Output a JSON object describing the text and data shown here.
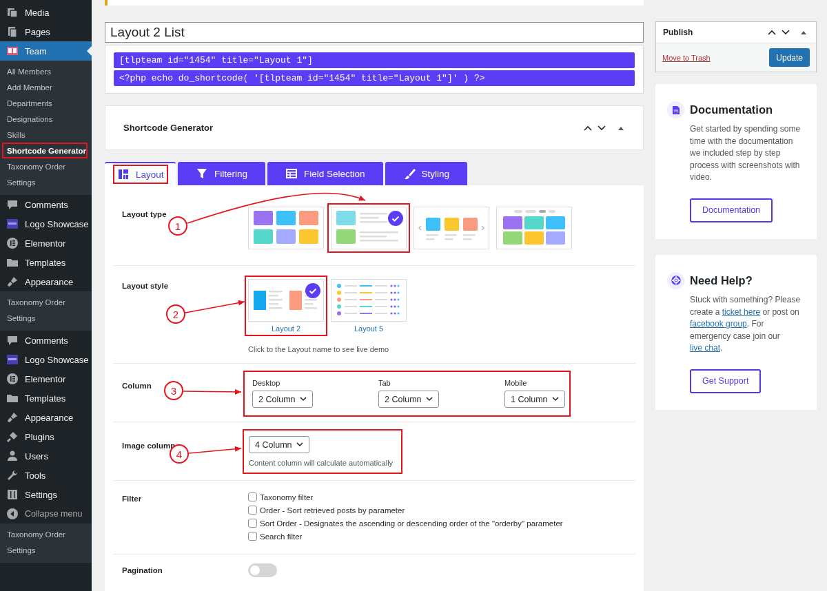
{
  "sidebar": {
    "items": [
      {
        "kind": "menu",
        "label": "Media",
        "selected": false
      },
      {
        "kind": "menu",
        "label": "Pages",
        "selected": false
      },
      {
        "kind": "menu",
        "label": "Team",
        "selected": true
      },
      {
        "kind": "submenu",
        "items": [
          {
            "label": "All Members",
            "current": false,
            "highlighted": false
          },
          {
            "label": "Add Member",
            "current": false,
            "highlighted": false
          },
          {
            "label": "Departments",
            "current": false,
            "highlighted": false
          },
          {
            "label": "Designations",
            "current": false,
            "highlighted": false
          },
          {
            "label": "Skills",
            "current": false,
            "highlighted": false
          },
          {
            "label": "Shortcode Generator",
            "current": true,
            "highlighted": true
          },
          {
            "label": "Taxonomy Order",
            "current": false,
            "highlighted": false
          },
          {
            "label": "Settings",
            "current": false,
            "highlighted": false
          }
        ]
      },
      {
        "kind": "menu",
        "label": "Comments",
        "selected": false
      },
      {
        "kind": "menu",
        "label": "Logo Showcase",
        "selected": false
      },
      {
        "kind": "menu",
        "label": "Elementor",
        "selected": false
      },
      {
        "kind": "menu",
        "label": "Templates",
        "selected": false
      },
      {
        "kind": "menu",
        "label": "Appearance",
        "selected": false
      },
      {
        "kind": "submenu",
        "items": [
          {
            "label": "Taxonomy Order",
            "current": false,
            "highlighted": false
          },
          {
            "label": "Settings",
            "current": false,
            "highlighted": false
          }
        ]
      },
      {
        "kind": "menu",
        "label": "Comments",
        "selected": false
      },
      {
        "kind": "menu",
        "label": "Logo Showcase",
        "selected": false
      },
      {
        "kind": "menu",
        "label": "Elementor",
        "selected": false
      },
      {
        "kind": "menu",
        "label": "Templates",
        "selected": false
      },
      {
        "kind": "menu",
        "label": "Appearance",
        "selected": false
      },
      {
        "kind": "menu",
        "label": "Plugins",
        "selected": false
      },
      {
        "kind": "menu",
        "label": "Users",
        "selected": false
      },
      {
        "kind": "menu",
        "label": "Tools",
        "selected": false
      },
      {
        "kind": "menu",
        "label": "Settings",
        "selected": false
      },
      {
        "kind": "collapse",
        "label": "Collapse menu",
        "selected": false
      },
      {
        "kind": "submenu",
        "items": [
          {
            "label": "Taxonomy Order",
            "current": false,
            "highlighted": false
          },
          {
            "label": "Settings",
            "current": false,
            "highlighted": false
          }
        ]
      }
    ]
  },
  "title_field": {
    "value": "Layout 2 List"
  },
  "shortcodes": [
    "[tlpteam id=\"1454\" title=\"Layout 1\"]",
    "<?php echo do_shortcode( '[tlpteam id=\"1454\" title=\"Layout 1\"]' ) ?>"
  ],
  "generator": {
    "title": "Shortcode Generator"
  },
  "tabs": [
    {
      "label": "Layout",
      "selected": true,
      "highlighted": true
    },
    {
      "label": "Filtering",
      "selected": false,
      "highlighted": false
    },
    {
      "label": "Field Selection",
      "selected": false,
      "highlighted": false
    },
    {
      "label": "Styling",
      "selected": false,
      "highlighted": false
    }
  ],
  "layout_type": {
    "label": "Layout type",
    "callout": "1",
    "options": [
      {
        "kind": "grid",
        "selected": false,
        "highlighted": false
      },
      {
        "kind": "list",
        "selected": true,
        "highlighted": true
      },
      {
        "kind": "carousel",
        "selected": false,
        "highlighted": false
      },
      {
        "kind": "isotope",
        "selected": false,
        "highlighted": false
      }
    ]
  },
  "layout_style": {
    "label": "Layout style",
    "callout": "2",
    "options": [
      {
        "name": "Layout 2",
        "kind": "cards",
        "selected": true,
        "highlighted": true
      },
      {
        "name": "Layout 5",
        "kind": "table",
        "selected": false,
        "highlighted": false
      }
    ],
    "hint": "Click to the Layout name to see live demo"
  },
  "column": {
    "label": "Column",
    "callout": "3",
    "highlighted": true,
    "selects": [
      {
        "label": "Desktop",
        "value": "2 Column"
      },
      {
        "label": "Tab",
        "value": "2 Column"
      },
      {
        "label": "Mobile",
        "value": "1 Column"
      }
    ]
  },
  "image_column": {
    "label": "Image column",
    "callout": "4",
    "highlighted": true,
    "value": "4 Column",
    "hint": "Content column will calculate automatically"
  },
  "filter": {
    "label": "Filter",
    "options": [
      {
        "label": "Taxonomy filter",
        "checked": false
      },
      {
        "label": "Order - Sort retrieved posts by parameter",
        "checked": false
      },
      {
        "label": "Sort Order - Designates the ascending or descending order of the \"orderby\" parameter",
        "checked": false
      },
      {
        "label": "Search filter",
        "checked": false
      }
    ]
  },
  "pagination": {
    "label": "Pagination",
    "on": false
  },
  "publish": {
    "title": "Publish",
    "trash": "Move to Trash",
    "button": "Update"
  },
  "cards": [
    {
      "kind": "docs",
      "title": "Documentation",
      "body": [
        {
          "text": "Get started by spending some time with the documentation we included step by step process with screenshots with video.",
          "link": false
        }
      ],
      "button": "Documentation"
    },
    {
      "kind": "help",
      "title": "Need Help?",
      "body": [
        {
          "text": "Stuck with something? Please create a",
          "link": false
        },
        {
          "text": "ticket here",
          "link": true
        },
        {
          "text": "or post on",
          "link": false
        },
        {
          "text": "facebook group",
          "link": true
        },
        {
          "text": ". For emergency case join our",
          "link": false
        },
        {
          "text": "live chat",
          "link": true
        },
        {
          "text": ".",
          "link": false
        }
      ],
      "button": "Get Support"
    }
  ]
}
